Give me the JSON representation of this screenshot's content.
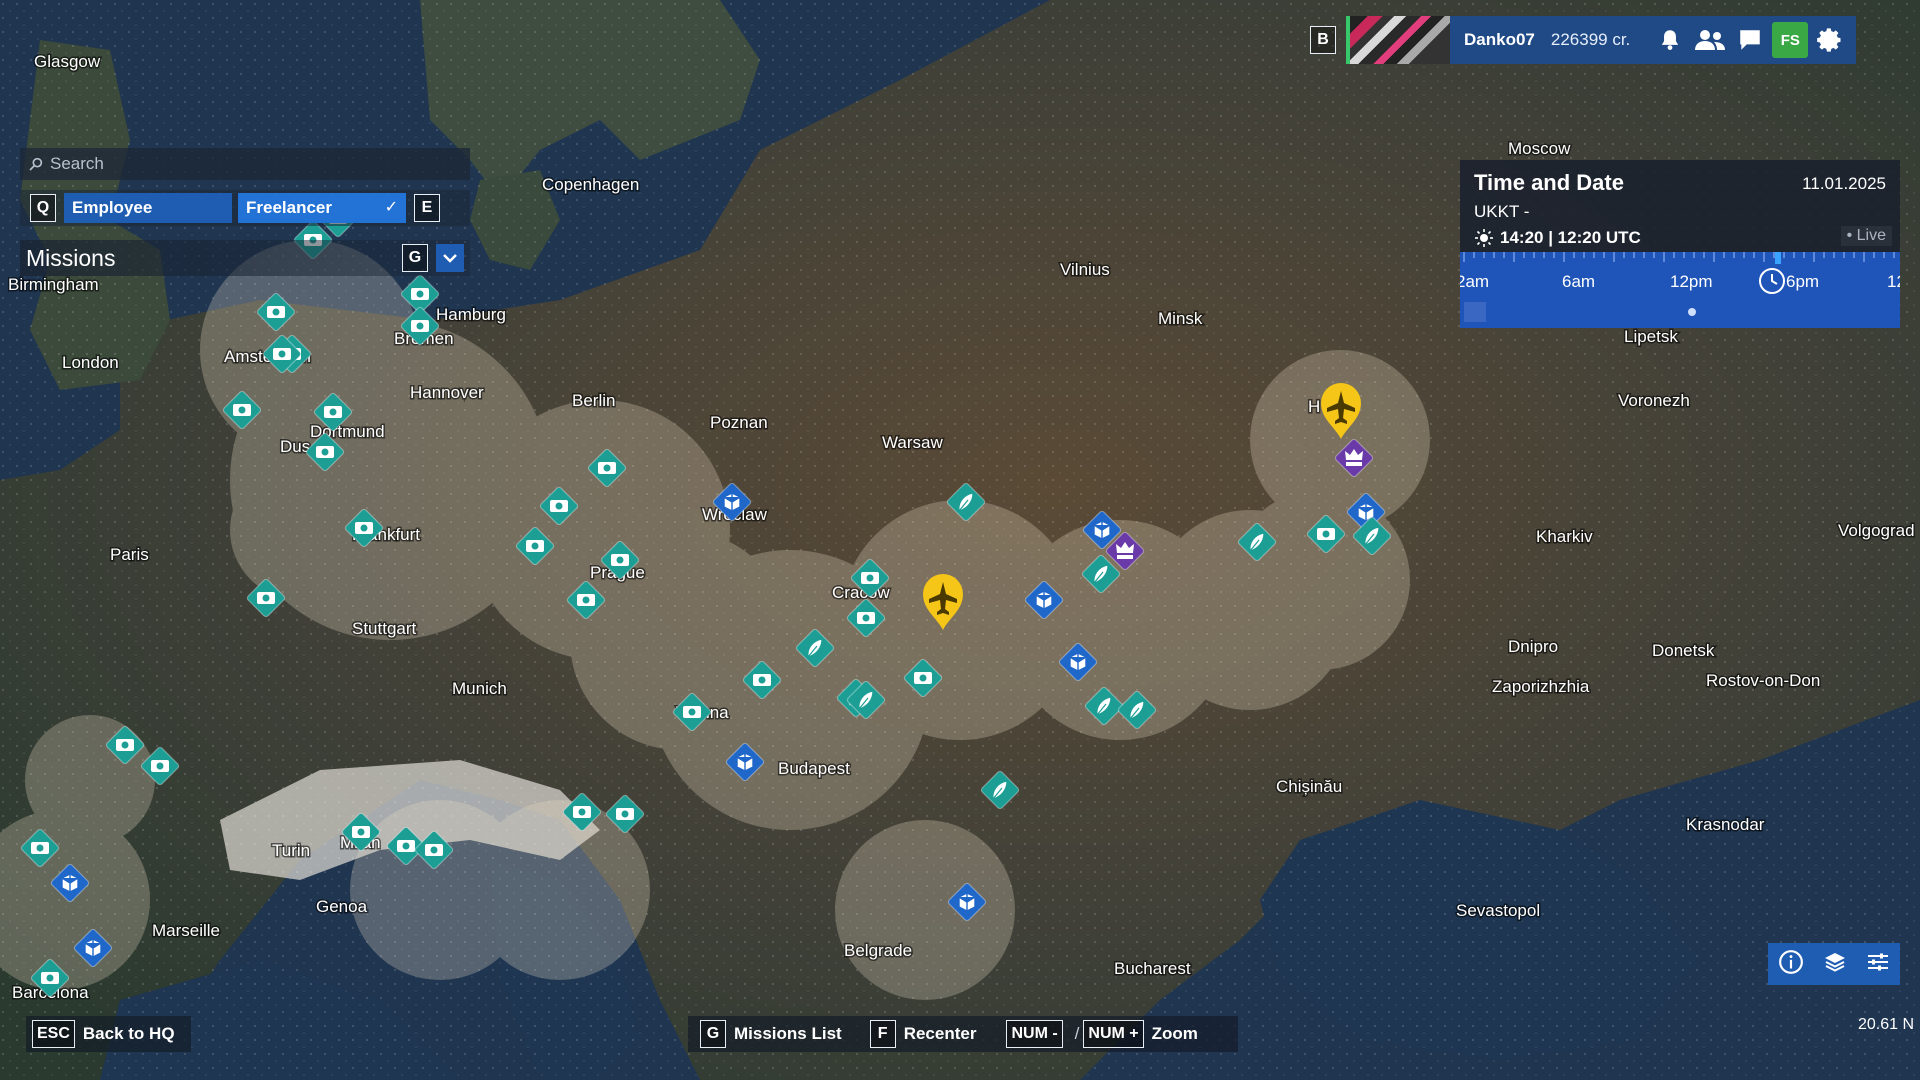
{
  "topbar": {
    "hotkey": "B",
    "player_name": "Danko07",
    "credits": "226399 cr.",
    "shop_label": "FS",
    "icons": [
      "bell-icon",
      "friends-icon",
      "chat-icon",
      "shop-icon",
      "gear-icon"
    ]
  },
  "search": {
    "placeholder": "Search",
    "icon": "search-icon"
  },
  "filters": {
    "prev_key": "Q",
    "next_key": "E",
    "employee": "Employee",
    "freelancer": "Freelancer"
  },
  "missions": {
    "title": "Missions",
    "key": "G"
  },
  "time_panel": {
    "title": "Time and Date",
    "date": "11.01.2025",
    "icao": "UKKT -",
    "time": "14:20 | 12:20 UTC",
    "live": "Live",
    "hours": [
      "2am",
      "6am",
      "12pm",
      "6pm",
      "12"
    ]
  },
  "bottom": {
    "esc_key": "ESC",
    "back": "Back to HQ",
    "missions_key": "G",
    "missions_list": "Missions List",
    "recenter_key": "F",
    "recenter": "Recenter",
    "zoom_out_key": "NUM -",
    "separator": "/",
    "zoom_in_key": "NUM +",
    "zoom": "Zoom"
  },
  "scale_readout": "20.61 N",
  "cities": {
    "glasgow": "Glasgow",
    "copenhagen": "Copenhagen",
    "moscow": "Moscow",
    "vilnius": "Vilnius",
    "minsk": "Minsk",
    "birmingham": "Birmingham",
    "hamburg": "Hamburg",
    "bremen": "Bremen",
    "london": "London",
    "amsterdam": "Amsterdam",
    "hannover": "Hannover",
    "berlin": "Berlin",
    "poznan": "Poznan",
    "warsaw": "Warsaw",
    "dortmund": "Dortmund",
    "dusseldorf": "Dus",
    "wroclaw": "Wroclaw",
    "frankfurt": "Frankfurt",
    "paris": "Paris",
    "prague": "Prague",
    "krakow": "Cracow",
    "stuttgart": "Stuttgart",
    "munich": "Munich",
    "vienna": "Vienna",
    "budapest": "Budapest",
    "turin": "Turin",
    "milan": "Milan",
    "genoa": "Genoa",
    "marseille": "Marseille",
    "barcelona": "Barcelona",
    "belgrade": "Belgrade",
    "bucharest": "Bucharest",
    "chisinau": "Chișinău",
    "kharkiv": "Kharkiv",
    "dnipro": "Dnipro",
    "donetsk": "Donetsk",
    "zaporizhzhia": "Zaporizhzhia",
    "rostov": "Rostov-on-Don",
    "lipetsk": "Lipetsk",
    "voronezh": "Voronezh",
    "volgograd": "Volgograd",
    "krasnodar": "Krasnodar",
    "sevastopol": "Sevastopol",
    "kyiv": "H"
  },
  "marker_types": {
    "camera": "camera-icon",
    "cargo": "cargo-box-icon",
    "feather": "feather-icon",
    "airport": "airport-pin-icon",
    "vip": "vip-icon"
  },
  "colors": {
    "marker_teal": "#1c9e95",
    "marker_blue": "#1f67c9",
    "airport_yellow": "#f5c518",
    "vip_purple": "#6a3aa8",
    "panel_blue": "#1f54b8"
  }
}
